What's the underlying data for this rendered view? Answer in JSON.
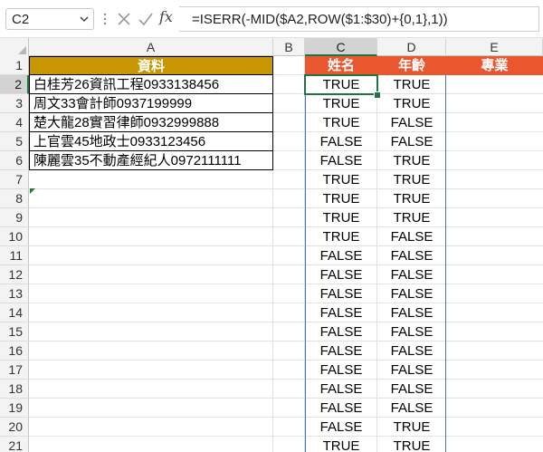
{
  "name_box": "C2",
  "formula": "=ISERR(-MID($A2,ROW($1:$30)+{0,1},1))",
  "fx_label": "fx",
  "columns": [
    "A",
    "B",
    "C",
    "D",
    "E"
  ],
  "rows": [
    "1",
    "2",
    "3",
    "4",
    "5",
    "6",
    "7",
    "8",
    "9",
    "10",
    "11",
    "12",
    "13",
    "14",
    "15",
    "16",
    "17",
    "18",
    "19",
    "20",
    "21"
  ],
  "headers": {
    "a1": "資料",
    "c1": "姓名",
    "d1": "年齡",
    "e1": "專業"
  },
  "header_colors": {
    "a1": "#C89600",
    "c1": "#E8572E",
    "d1": "#E8572E",
    "e1": "#E8572E"
  },
  "col_a_data": [
    "白桂芳26資訊工程0933138456",
    "周文33會計師0937199999",
    "楚大龍28實習律師0932999888",
    "上官雲45地政士0933123456",
    "陳麗雲35不動產經紀人0972111111"
  ],
  "col_c": [
    "TRUE",
    "TRUE",
    "TRUE",
    "FALSE",
    "FALSE",
    "TRUE",
    "TRUE",
    "TRUE",
    "TRUE",
    "FALSE",
    "FALSE",
    "FALSE",
    "FALSE",
    "FALSE",
    "FALSE",
    "FALSE",
    "FALSE",
    "FALSE",
    "FALSE",
    "TRUE"
  ],
  "col_d": [
    "TRUE",
    "TRUE",
    "FALSE",
    "FALSE",
    "TRUE",
    "TRUE",
    "TRUE",
    "TRUE",
    "FALSE",
    "FALSE",
    "FALSE",
    "FALSE",
    "FALSE",
    "FALSE",
    "FALSE",
    "FALSE",
    "FALSE",
    "FALSE",
    "TRUE",
    "TRUE"
  ],
  "colors": {
    "selection": "#217346",
    "table_border": "#000000",
    "blue_border": "#4472C4"
  },
  "icons": {
    "cancel": "close-icon",
    "enter": "check-icon",
    "insert_function": "fx-icon"
  }
}
